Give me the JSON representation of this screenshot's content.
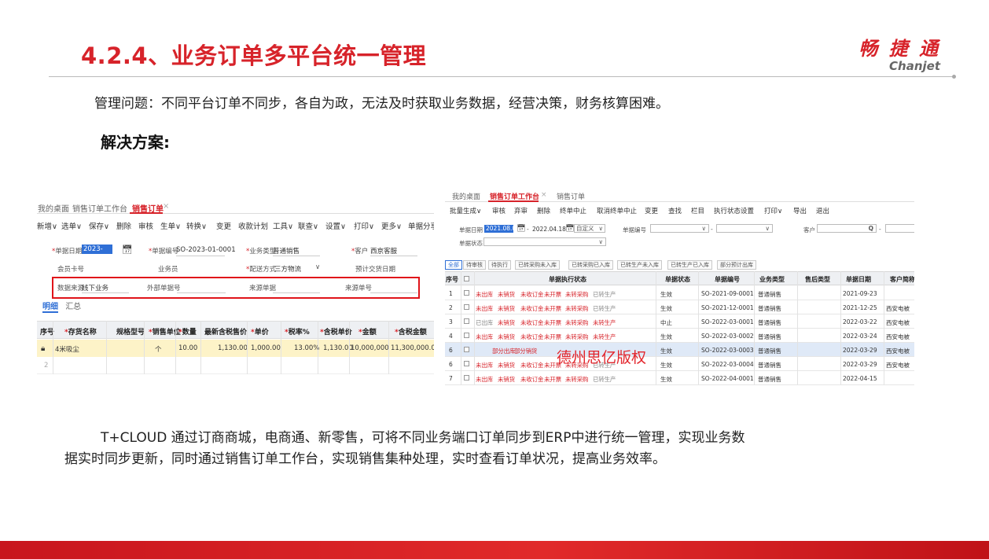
{
  "slide": {
    "title": "4.2.4、业务订单多平台统一管理",
    "logo_cn": "畅 捷 通",
    "logo_en": "Chanjet",
    "problem": "管理问题：不同平台订单不同步，各自为政，无法及时获取业务数据，经营决策，财务核算困难。",
    "solution_heading": "解决方案:",
    "description_line1": "T+CLOUD 通过订商商城，电商通、新零售，可将不同业务端口订单同步到ERP中进行统一管理，实现业务数",
    "description_line2": "据实时同步更新，同时通过销售订单工作台，实现销售集种处理，实时查看订单状况，提高业务效率。"
  },
  "left_screen": {
    "tabs": [
      "我的桌面",
      "销售订单工作台",
      "销售订单"
    ],
    "tab_close": "×",
    "toolbar": [
      "新增∨",
      "选单∨",
      "保存∨",
      "删除",
      "审核",
      "生单∨",
      "转换∨",
      "变更",
      "收款计划",
      "工具∨",
      "联查∨",
      "设置∨",
      "打印∨",
      "更多∨",
      "单据分享"
    ],
    "form": {
      "date_label": "单据日期",
      "date_value": "2023-01-21",
      "number_label": "单据编号",
      "number_value": "SO-2023-01-0001",
      "biztype_label": "业务类型",
      "biztype_value": "普通销售",
      "customer_label": "客户",
      "customer_value": "西京客服",
      "member_label": "会员卡号",
      "salesman_label": "业务员",
      "delivery_label": "配送方式",
      "delivery_value": "三方物流",
      "expected_label": "预计交货日期",
      "source_label": "数据来源",
      "source_value": "线下业务",
      "external_label": "外部单据号",
      "source_doc_label": "来源单据",
      "source_no_label": "来源单号"
    },
    "subtabs": [
      "明细",
      "汇总"
    ],
    "columns": [
      "序号",
      "存货名称",
      "规格型号",
      "销售单位",
      "数量",
      "最新含税售价",
      "单价",
      "税率%",
      "含税单价",
      "金额",
      "含税金额"
    ],
    "rows": [
      [
        "1",
        "4米吸尘",
        "",
        "个",
        "10.00",
        "1,130.00",
        "1,000.00",
        "13.00%",
        "1,130.00",
        "10,000,000",
        "11,300,000.00"
      ],
      [
        "2",
        "",
        "",
        "",
        "",
        "",
        "",
        "",
        "",
        "",
        ""
      ]
    ]
  },
  "right_screen": {
    "tabs": [
      "我的桌面",
      "销售订单工作台",
      "销售订单"
    ],
    "tab_close": "×",
    "toolbar": [
      "批量生成∨",
      "审核",
      "弃审",
      "删除",
      "终单中止",
      "取消终单中止",
      "变更",
      "查找",
      "栏目",
      "执行状态设置",
      "打印∨",
      "导出",
      "退出"
    ],
    "filter": {
      "date_label": "单据日期",
      "date_from": "2021.08.01",
      "date_sep": "-",
      "date_to": "2022.04.18",
      "period": "自定义",
      "number_label": "单据编号",
      "status_label": "单据状态",
      "customer_label": "客户",
      "search_icon": "Q",
      "dash": "-"
    },
    "status_tabs": [
      "全部",
      "待审核",
      "待执行",
      "已转采购未入库",
      "已转采购已入库",
      "已转生产未入库",
      "已转生产已入库",
      "部分预计出库"
    ],
    "columns": [
      "序号",
      "单据执行状态",
      "单据状态",
      "单据编号",
      "业务类型",
      "售后类型",
      "单据日期",
      "客户简称"
    ],
    "rows": [
      {
        "no": "1",
        "exec": [
          "未出库",
          "未销货",
          "未收订金",
          "未开票",
          "未转采购",
          "已转生产"
        ],
        "status": "生效",
        "number": "SO-2021-09-0001",
        "biz": "普通销售",
        "date": "2021-09-23",
        "customer": ""
      },
      {
        "no": "2",
        "exec": [
          "未出库",
          "未销货",
          "未收订金",
          "未开票",
          "未转采购",
          "已转生产"
        ],
        "status": "生效",
        "number": "SO-2021-12-0001",
        "biz": "普通销售",
        "date": "2021-12-25",
        "customer": "西安电被"
      },
      {
        "no": "3",
        "exec": [
          "已出库",
          "未销货",
          "未收订金",
          "未开票",
          "未转采购",
          "未转生产"
        ],
        "status": "中止",
        "number": "SO-2022-03-0001",
        "biz": "普通销售",
        "date": "2022-03-22",
        "customer": "西安电被"
      },
      {
        "no": "4",
        "exec": [
          "未出库",
          "未销货",
          "未收订金",
          "未开票",
          "未转采购",
          "未转生产"
        ],
        "status": "生效",
        "number": "SO-2022-03-0002",
        "biz": "普通销售",
        "date": "2022-03-24",
        "customer": "西安电被"
      },
      {
        "no": "6",
        "exec": [
          "部分出库",
          "部分销货"
        ],
        "status": "生效",
        "number": "SO-2022-03-0003",
        "biz": "普通销售",
        "date": "2022-03-29",
        "customer": "西安电被"
      },
      {
        "no": "6",
        "exec": [
          "未出库",
          "未销货",
          "未收订金",
          "未开票",
          "未转采购",
          "已转生产"
        ],
        "status": "生效",
        "number": "SO-2022-03-0004",
        "biz": "普通销售",
        "date": "2022-03-29",
        "customer": "西安电被"
      },
      {
        "no": "7",
        "exec": [
          "未出库",
          "未销货",
          "未收订金",
          "未开票",
          "未转采购",
          "已转生产"
        ],
        "status": "生效",
        "number": "SO-2022-04-0001",
        "biz": "普通销售",
        "date": "2022-04-15",
        "customer": ""
      }
    ],
    "watermark": "德州思亿版权"
  },
  "colors": {
    "brand_red": "#d7232a",
    "highlight_blue": "#2f6fd6",
    "row_yellow": "#fdf3c8",
    "row_selected": "#dfe9f7"
  }
}
